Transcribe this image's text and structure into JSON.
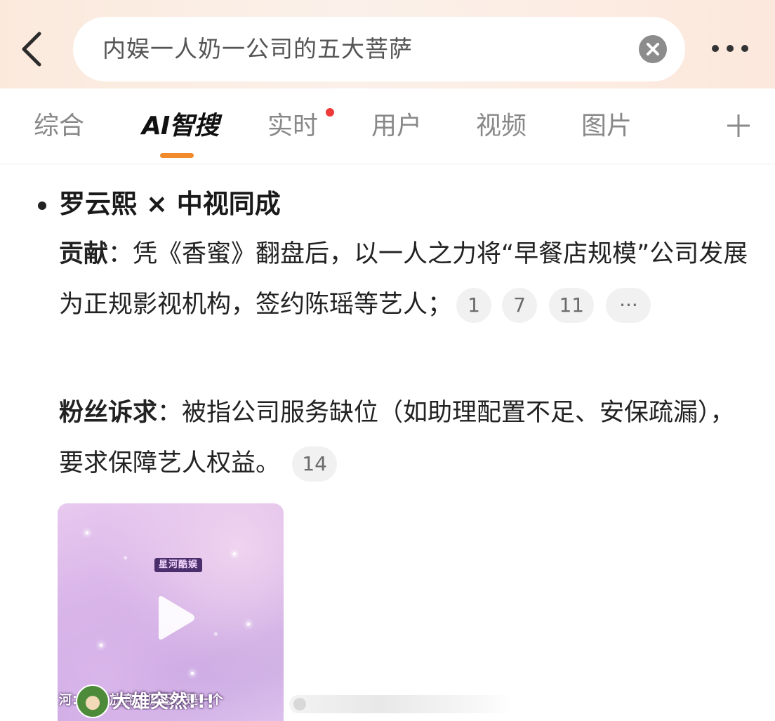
{
  "search": {
    "query": "内娱一人奶一公司的五大菩萨"
  },
  "tabs": [
    {
      "label": "综合"
    },
    {
      "label": "AI智搜"
    },
    {
      "label": "实时"
    },
    {
      "label": "用户"
    },
    {
      "label": "视频"
    },
    {
      "label": "图片"
    }
  ],
  "result": {
    "title": "罗云熙 × 中视同成",
    "contribution_label": "贡献",
    "contribution_text": "：凭《香蜜》翻盘后，以一人之力将“早餐店规模”公司发展为正规影视机构，签约陈瑶等艺人；",
    "contribution_refs": [
      "1",
      "7",
      "11",
      "···"
    ],
    "fans_label": "粉丝诉求",
    "fans_text": "：被指公司服务缺位（如助理配置不足、安保疏漏），要求保障艺人权益。",
    "fans_refs": [
      "14"
    ]
  },
  "video": {
    "badge": "星河酷娱",
    "caption_small": "河：下背放弃的原因就是一个",
    "caption_big": "大雄突然!!!"
  },
  "colors": {
    "accent": "#f08a2a",
    "notification_dot": "#f03a3a"
  },
  "icons": [
    "back-arrow-icon",
    "clear-icon",
    "more-icon",
    "plus-icon",
    "play-icon"
  ]
}
